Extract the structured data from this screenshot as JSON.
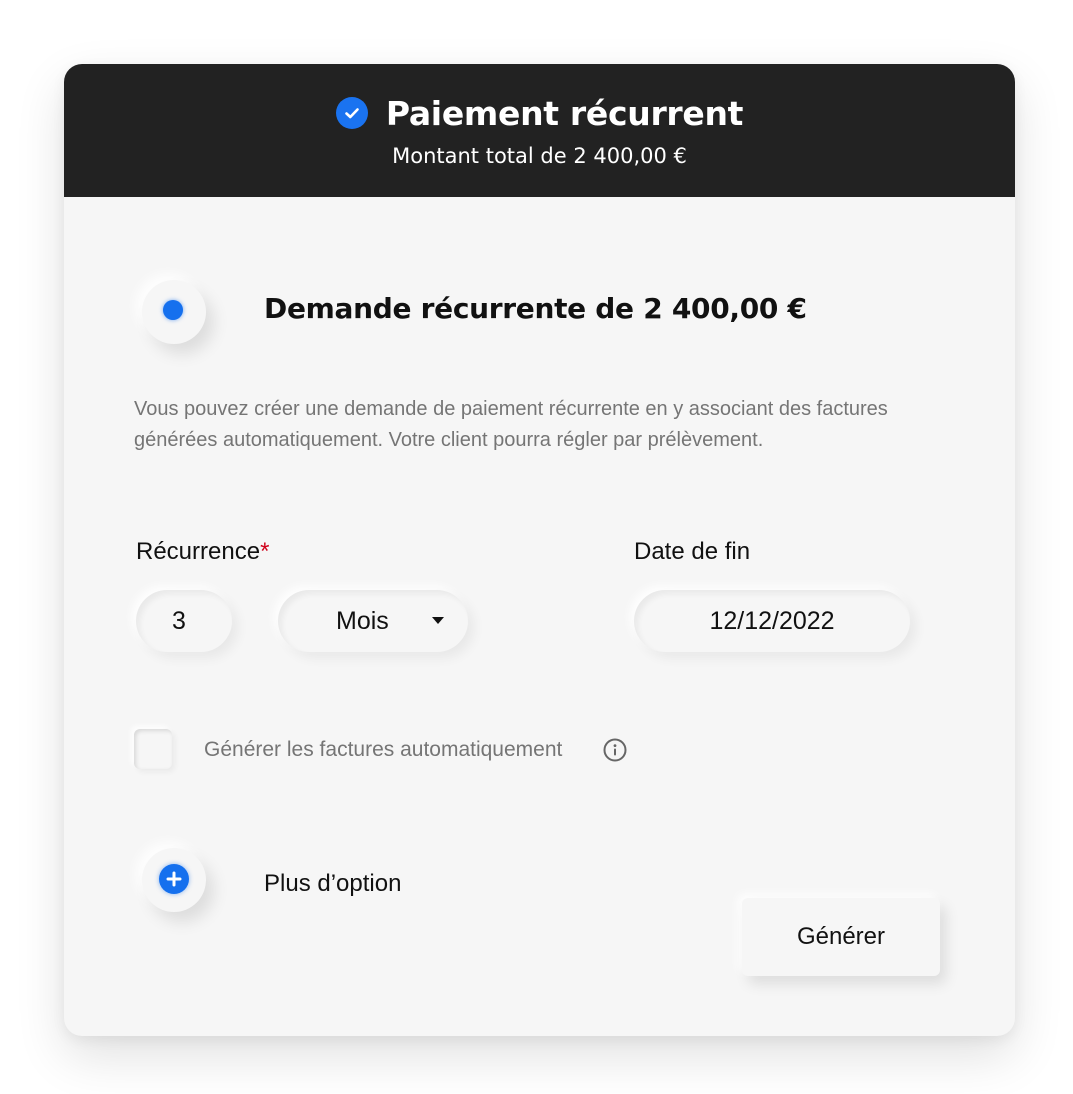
{
  "header": {
    "title": "Paiement récurrent",
    "subtitle": "Montant total de 2 400,00 €",
    "icon": "check-circle-icon"
  },
  "option": {
    "title": "Demande récurrente de 2 400,00 €",
    "selected": true,
    "description": "Vous pouvez créer une demande de paiement récurrente en y associant des factures générées automatiquement. Votre client pourra régler par prélèvement."
  },
  "recurrence": {
    "label": "Récurrence",
    "required_mark": "*",
    "count": "3",
    "unit": "Mois"
  },
  "end_date": {
    "label": "Date de fin",
    "value": "12/12/2022"
  },
  "auto_invoice": {
    "label": "Générer les factures automatiquement",
    "checked": false
  },
  "more": {
    "label": "Plus d’option"
  },
  "actions": {
    "generate_label": "Générer"
  },
  "colors": {
    "accent": "#1570ee",
    "header_bg": "#222222",
    "card_bg": "#f6f6f6",
    "required": "#d0021b"
  }
}
